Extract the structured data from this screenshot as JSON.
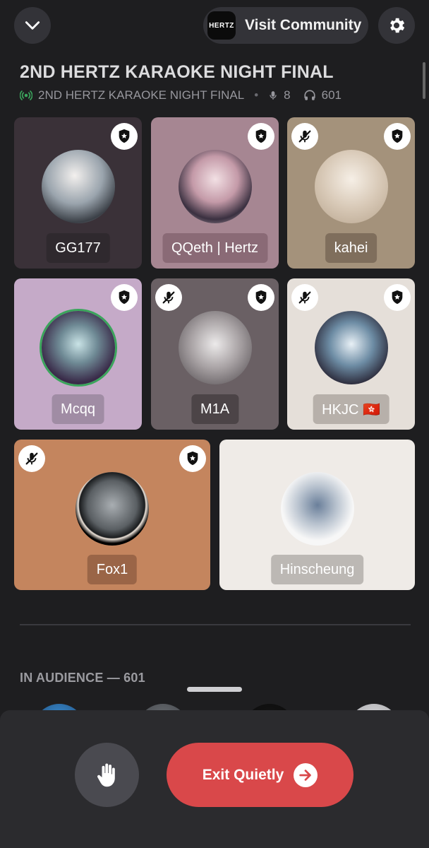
{
  "header": {
    "visit_label": "Visit Community",
    "community_logo_text": "HERTZ"
  },
  "stage": {
    "title": "2ND HERTZ KARAOKE NIGHT FINAL",
    "topic": "2ND HERTZ KARAOKE NIGHT FINAL",
    "speaker_count": "8",
    "listener_count": "601"
  },
  "speakers": [
    {
      "name": "GG177",
      "muted": false,
      "moderator": true,
      "tile_color": "#3a3138"
    },
    {
      "name": "QQeth | Hertz",
      "muted": false,
      "moderator": true,
      "tile_color": "#a68692"
    },
    {
      "name": "kahei",
      "muted": true,
      "moderator": true,
      "tile_color": "#a4927b"
    },
    {
      "name": "Mcqq",
      "muted": false,
      "moderator": true,
      "tile_color": "#c5aac8"
    },
    {
      "name": "M1A",
      "muted": true,
      "moderator": true,
      "tile_color": "#6a6064"
    },
    {
      "name": "HKJC 🇭🇰",
      "muted": true,
      "moderator": true,
      "tile_color": "#e5dfd9"
    },
    {
      "name": "Fox1",
      "muted": true,
      "moderator": true,
      "tile_color": "#c4855e"
    },
    {
      "name": "Hinscheung",
      "muted": false,
      "moderator": false,
      "tile_color": "#efebe7"
    }
  ],
  "audience": {
    "heading": "IN AUDIENCE — 601"
  },
  "actions": {
    "exit_label": "Exit Quietly",
    "raise_hand_icon": "raise-hand-icon"
  },
  "colors": {
    "background": "#1e1e20",
    "exit_button": "#d9484a",
    "live_indicator": "#3ba55c"
  }
}
